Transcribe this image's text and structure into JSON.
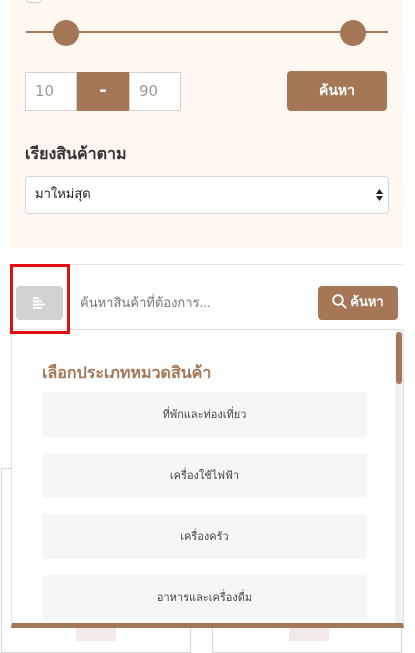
{
  "filter": {
    "price_min": "10",
    "price_sep": "-",
    "price_max": "90",
    "search_label": "ค้นหา",
    "sort_label": "เรียงสินค้าตาม",
    "sort_value": "มาใหม่สุด"
  },
  "search": {
    "placeholder": "ค้นหาสินค้าที่ต้องการ...",
    "button_label": "ค้นหา"
  },
  "categories": {
    "title": "เลือกประเภทหมวดสินค้า",
    "items": [
      "ที่พักและท่องเที่ยว",
      "เครื่องใช้ไฟฟ้า",
      "เครื่องครัว",
      "อาหารและเครื่องดื่ม"
    ]
  },
  "colors": {
    "accent": "#a57756",
    "panel_bg": "#fff8f1",
    "highlight": "#e01010"
  }
}
